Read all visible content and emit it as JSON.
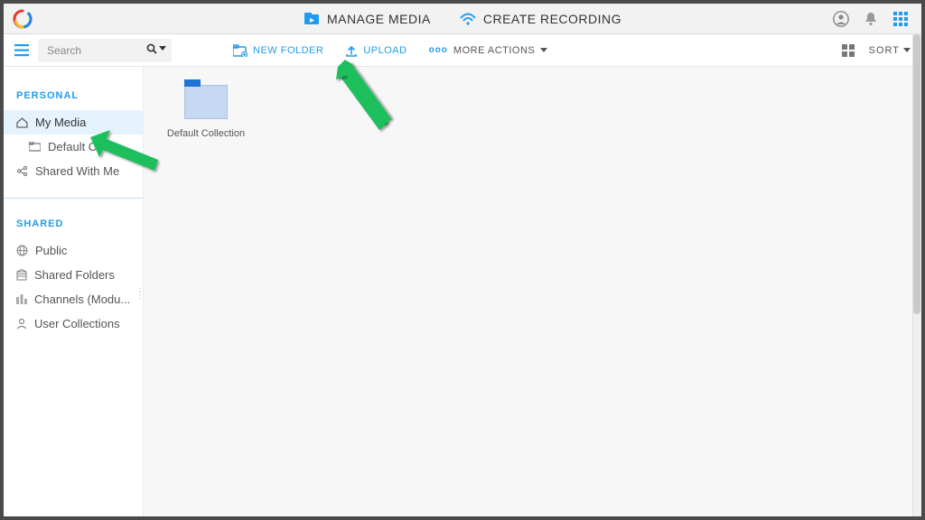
{
  "topbar": {
    "manage_media": "MANAGE MEDIA",
    "create_recording": "CREATE RECORDING"
  },
  "toolbar": {
    "search_placeholder": "Search",
    "new_folder": "NEW FOLDER",
    "upload": "UPLOAD",
    "more_actions": "MORE ACTIONS",
    "sort": "SORT"
  },
  "sidebar": {
    "personal_title": "PERSONAL",
    "shared_title": "SHARED",
    "personal": {
      "my_media": "My Media",
      "default_collection": "Default Coll...",
      "shared_with_me": "Shared With Me"
    },
    "shared": {
      "public": "Public",
      "shared_folders": "Shared Folders",
      "channels": "Channels (Modu...",
      "user_collections": "User Collections"
    }
  },
  "content": {
    "default_collection": "Default Collection"
  },
  "colors": {
    "accent": "#209cee",
    "arrow": "#1bbf5c"
  }
}
